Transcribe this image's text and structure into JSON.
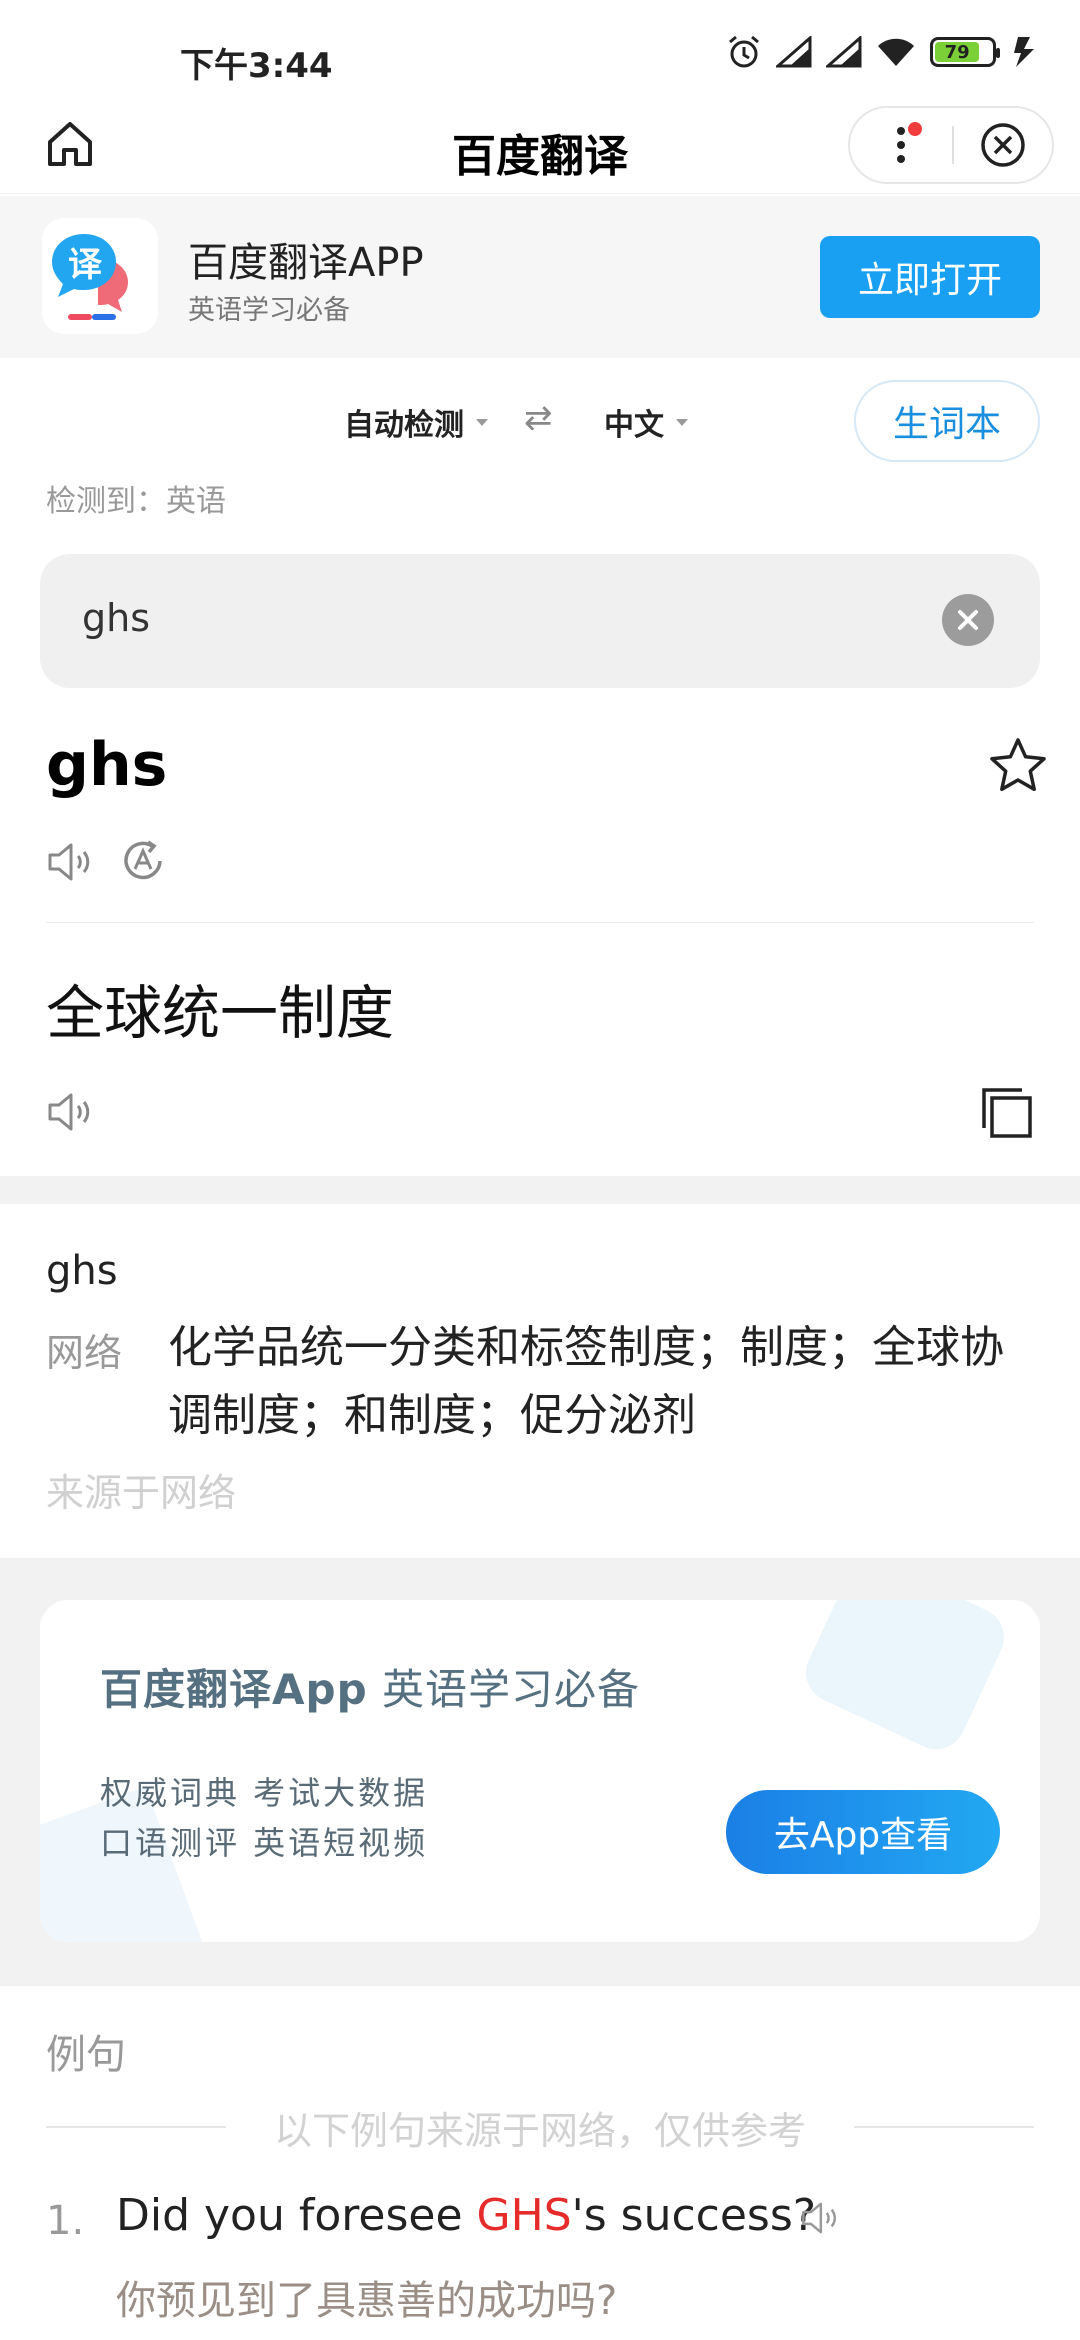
{
  "status_bar": {
    "time": "下午3:44",
    "battery_level": "79",
    "icons": [
      "alarm-icon",
      "signal-icon",
      "signal-icon",
      "wifi-icon",
      "battery-icon",
      "charging-icon"
    ]
  },
  "nav": {
    "title": "百度翻译",
    "home_icon": "home-icon",
    "more_icon": "more-dots-icon",
    "close_icon": "close-circle-icon"
  },
  "banner": {
    "app_name": "百度翻译APP",
    "subtitle": "英语学习必备",
    "open_label": "立即打开",
    "icon_glyph": "译"
  },
  "language": {
    "source": "自动检测",
    "target": "中文",
    "swap_glyph": "⇄",
    "wordbook_label": "生词本",
    "detected": "检测到：英语"
  },
  "input": {
    "value": "ghs"
  },
  "result": {
    "source_word": "ghs",
    "translation": "全球统一制度"
  },
  "dictionary": {
    "word": "ghs",
    "tag": "网络",
    "definition": "化学品统一分类和标签制度；制度；全球协调制度；和制度；促分泌剂",
    "source_note": "来源于网络"
  },
  "promo": {
    "title_app": "百度翻译App",
    "title_rest": " 英语学习必备",
    "line1": "权威词典 考试大数据",
    "line2": "口语测评 英语短视频",
    "button_label": "去App查看"
  },
  "examples": {
    "header": "例句",
    "note": "以下例句来源于网络，仅供参考",
    "items": [
      {
        "num": "1.",
        "en_before": "Did you foresee ",
        "en_highlight": "GHS",
        "en_after": "'s success?",
        "zh": "你预见到了具惠善的成功吗?"
      }
    ]
  },
  "colors": {
    "accent": "#1aa0f3",
    "highlight": "#e62b2b",
    "battery": "#7bd037"
  }
}
